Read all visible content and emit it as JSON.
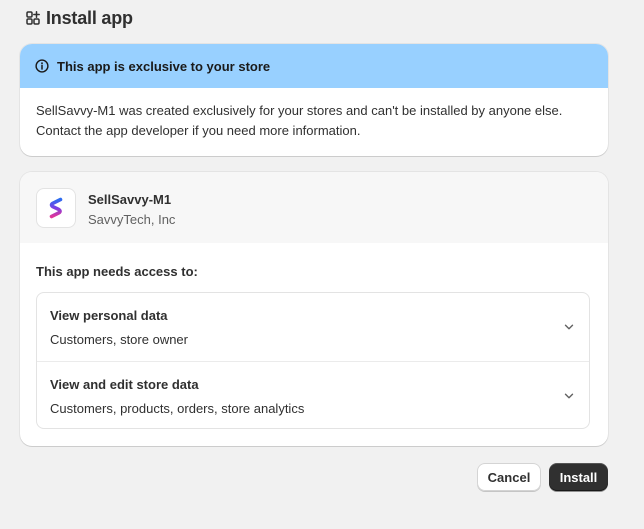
{
  "page": {
    "title": "Install app",
    "title_icon": "apps-add-icon"
  },
  "banner": {
    "icon": "info-icon",
    "title": "This app is exclusive to your store",
    "body": "SellSavvy-M1 was created exclusively for your stores and can't be installed by anyone else. Contact the app developer if you need more information.",
    "color": "#98d0ff"
  },
  "app": {
    "name": "SellSavvy-M1",
    "developer": "SavvyTech, Inc",
    "icon": "sellsavvy-logo"
  },
  "access": {
    "title": "This app needs access to:",
    "items": [
      {
        "title": "View personal data",
        "description": "Customers, store owner"
      },
      {
        "title": "View and edit store data",
        "description": "Customers, products, orders, store analytics"
      }
    ]
  },
  "actions": {
    "cancel_label": "Cancel",
    "install_label": "Install"
  }
}
